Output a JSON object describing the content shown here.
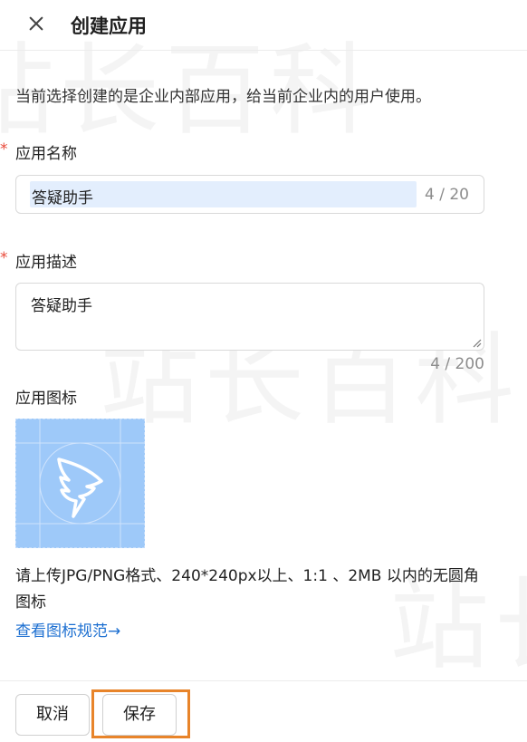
{
  "header": {
    "title": "创建应用"
  },
  "notice": "当前选择创建的是企业内部应用，给当前企业内的用户使用。",
  "app_name": {
    "required_mark": "*",
    "label": "应用名称",
    "value": "答疑助手",
    "count": "4 / 20"
  },
  "app_desc": {
    "required_mark": "*",
    "label": "应用描述",
    "value": "答疑助手",
    "count": "4 / 200"
  },
  "app_icon": {
    "label": "应用图标",
    "hint": "请上传JPG/PNG格式、240*240px以上、1:1 、2MB 以内的无圆角图标",
    "spec_link": "查看图标规范→"
  },
  "footer": {
    "cancel_label": "取消",
    "save_label": "保存"
  },
  "watermark": "站长百科",
  "colors": {
    "required": "#e84a3a",
    "link": "#1c6fd1",
    "icon_bg": "#9ec9f9",
    "highlight_outline": "#e8842a"
  }
}
